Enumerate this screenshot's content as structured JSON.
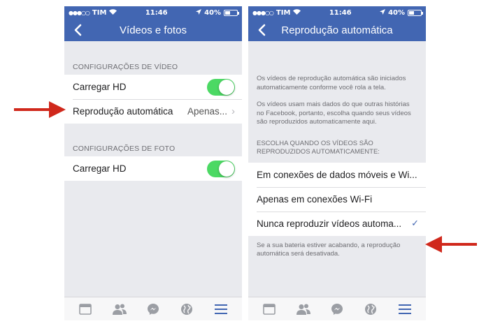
{
  "colors": {
    "brand": "#4266b2",
    "toggle_on": "#4cd964",
    "arrow": "#d0281c",
    "tab_inactive": "#9b9ea4"
  },
  "status_bar": {
    "carrier": "TIM",
    "time": "11:46",
    "battery": "40%",
    "battery_level": 0.4
  },
  "left_screen": {
    "title": "Vídeos e fotos",
    "video_section_header": "CONFIGURAÇÕES DE VÍDEO",
    "video_rows": {
      "hd_label": "Carregar HD",
      "hd_enabled": true,
      "autoplay_label": "Reprodução automática",
      "autoplay_value": "Apenas..."
    },
    "photo_section_header": "CONFIGURAÇÕES DE FOTO",
    "photo_rows": {
      "hd_label": "Carregar HD",
      "hd_enabled": true
    }
  },
  "right_screen": {
    "title": "Reprodução automática",
    "desc1": "Os vídeos de reprodução automática são iniciados automaticamente conforme você rola a tela.",
    "desc2": "Os vídeos usam mais dados do que outras histórias no Facebook, portanto, escolha quando seus vídeos são reproduzidos automaticamente aqui.",
    "choose_header": "ESCOLHA QUANDO OS VÍDEOS SÃO REPRODUZIDOS AUTOMATICAMENTE:",
    "options": [
      {
        "label": "Em conexões de dados móveis e Wi...",
        "selected": false
      },
      {
        "label": "Apenas em conexões Wi-Fi",
        "selected": false
      },
      {
        "label": "Nunca reproduzir vídeos automa...",
        "selected": true
      }
    ],
    "check_symbol": "✓",
    "footer": "Se a sua bateria estiver acabando, a reprodução automática será desativada."
  },
  "tabbar": {
    "icons": [
      "news-feed-icon",
      "friends-icon",
      "messenger-icon",
      "globe-icon",
      "menu-icon"
    ],
    "active": "menu-icon"
  }
}
